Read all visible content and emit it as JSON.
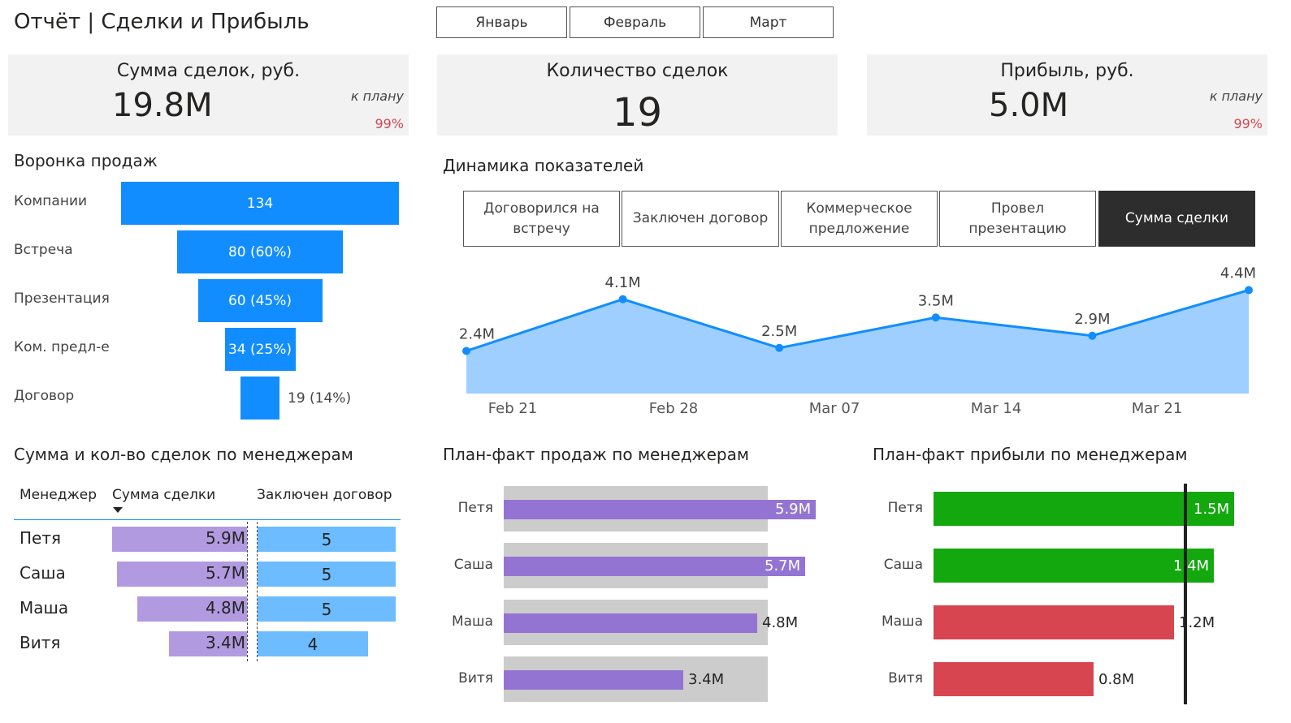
{
  "title": "Отчёт | Сделки и Прибыль",
  "slicer": [
    "Январь",
    "Февраль",
    "Март"
  ],
  "cards": {
    "sum": {
      "title": "Сумма сделок, руб.",
      "value": "19.8M",
      "plan_label": "к плану",
      "plan_pct": "99%"
    },
    "count": {
      "title": "Количество сделок",
      "value": "19"
    },
    "profit": {
      "title": "Прибыль, руб.",
      "value": "5.0M",
      "plan_label": "к плану",
      "plan_pct": "99%"
    }
  },
  "funnel": {
    "title": "Воронка продаж",
    "stages": [
      {
        "label": "Компании",
        "value": 134,
        "text": "134"
      },
      {
        "label": "Встреча",
        "value": 80,
        "text": "80 (60%)"
      },
      {
        "label": "Презентация",
        "value": 60,
        "text": "60 (45%)"
      },
      {
        "label": "Ком. предл-е",
        "value": 34,
        "text": "34 (25%)"
      },
      {
        "label": "Договор",
        "value": 19,
        "text": "19 (14%)"
      }
    ]
  },
  "dynamics": {
    "title": "Динамика показателей",
    "tabs": [
      "Договорился на встречу",
      "Заключен договор",
      "Коммерческое предложение",
      "Провел презентацию",
      "Сумма сделки"
    ],
    "active_tab": 4
  },
  "chart_data": {
    "type": "area",
    "x": [
      "Feb 19",
      "Feb 26",
      "Mar 05",
      "Mar 12",
      "Mar 19",
      "Mar 26"
    ],
    "values": [
      2.4,
      4.1,
      2.5,
      3.5,
      2.9,
      4.4
    ],
    "labels": [
      "2.4M",
      "4.1M",
      "2.5M",
      "3.5M",
      "2.9M",
      "4.4M"
    ],
    "xticks": [
      "Feb 21",
      "Feb 28",
      "Mar 07",
      "Mar 14",
      "Mar 21"
    ],
    "ylim": [
      1.0,
      5.0
    ],
    "line_color": "#118dff",
    "fill_color": "#9fcfff"
  },
  "managers_table": {
    "title": "Сумма и кол-во сделок по менеджерам",
    "headers": [
      "Менеджер",
      "Сумма сделки",
      "Заключен договор"
    ],
    "rows": [
      {
        "name": "Петя",
        "sum": 5.9,
        "sum_text": "5.9M",
        "count": 5,
        "count_text": "5"
      },
      {
        "name": "Саша",
        "sum": 5.7,
        "sum_text": "5.7M",
        "count": 5,
        "count_text": "5"
      },
      {
        "name": "Маша",
        "sum": 4.8,
        "sum_text": "4.8M",
        "count": 5,
        "count_text": "5"
      },
      {
        "name": "Витя",
        "sum": 3.4,
        "sum_text": "3.4M",
        "count": 4,
        "count_text": "4"
      }
    ]
  },
  "plan_fact_sales": {
    "title": "План-факт продаж по менеджерам",
    "rows": [
      {
        "name": "Петя",
        "fact": 5.9,
        "fact_text": "5.9M",
        "plan": 5.0
      },
      {
        "name": "Саша",
        "fact": 5.7,
        "fact_text": "5.7M",
        "plan": 5.0
      },
      {
        "name": "Маша",
        "fact": 4.8,
        "fact_text": "4.8M",
        "plan": 5.0
      },
      {
        "name": "Витя",
        "fact": 3.4,
        "fact_text": "3.4M",
        "plan": 5.0
      }
    ]
  },
  "plan_fact_profit": {
    "title": "План-факт прибыли по менеджерам",
    "target": 1.25,
    "rows": [
      {
        "name": "Петя",
        "fact": 1.5,
        "fact_text": "1.5M",
        "color": "#13a90e"
      },
      {
        "name": "Саша",
        "fact": 1.4,
        "fact_text": "1.4M",
        "color": "#13a90e"
      },
      {
        "name": "Маша",
        "fact": 1.2,
        "fact_text": "1.2M",
        "color": "#d64550"
      },
      {
        "name": "Витя",
        "fact": 0.8,
        "fact_text": "0.8M",
        "color": "#d64550"
      }
    ]
  }
}
